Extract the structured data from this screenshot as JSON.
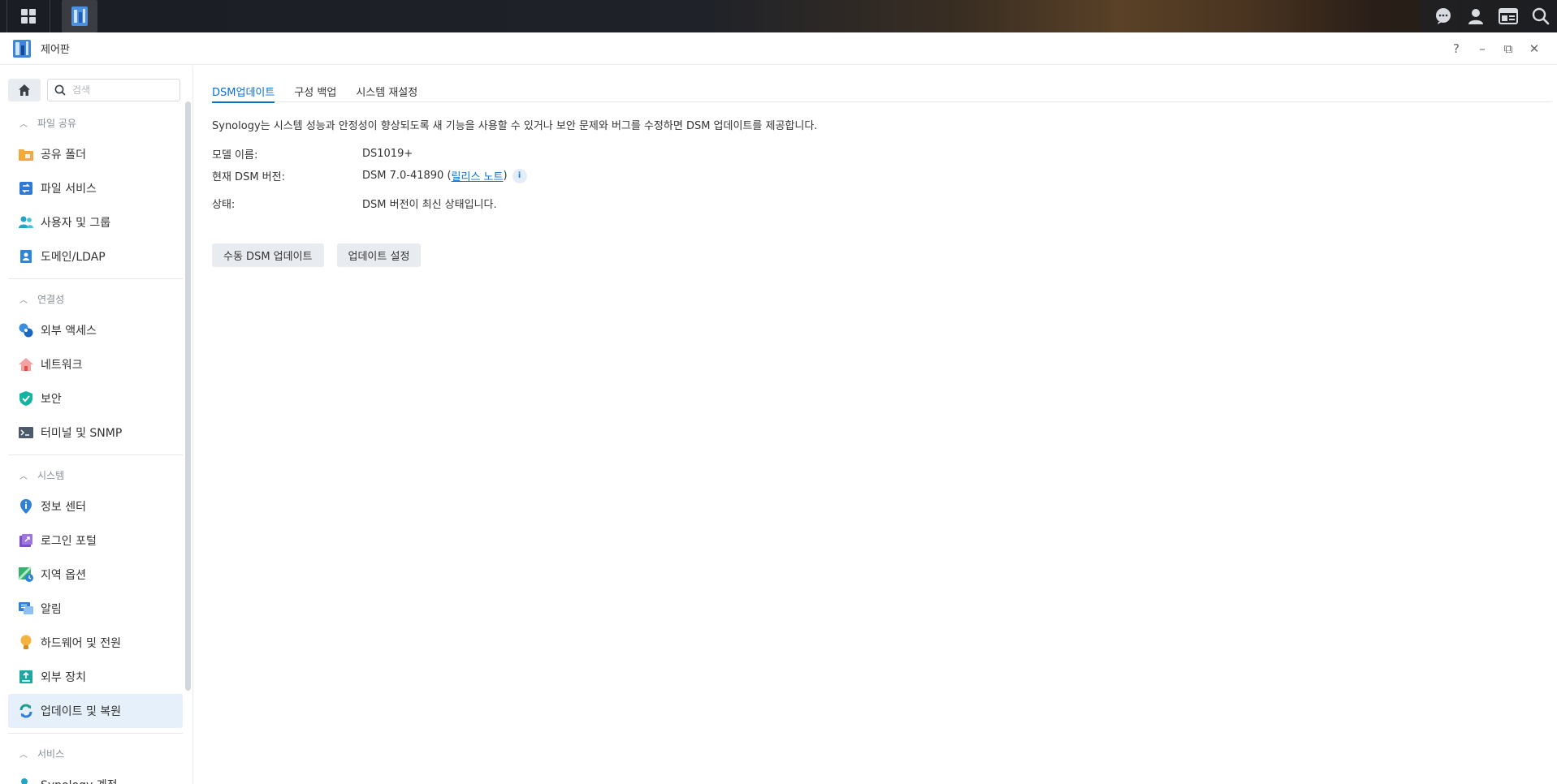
{
  "window": {
    "title": "제어판"
  },
  "window_controls": {
    "help": "?",
    "minimize": "–",
    "restore": "⧉",
    "close": "✕"
  },
  "search": {
    "placeholder": "검색"
  },
  "sidebar": {
    "sections": [
      {
        "label": "파일 공유",
        "items": [
          {
            "label": "공유 폴더",
            "icon": "shared-folder-icon"
          },
          {
            "label": "파일 서비스",
            "icon": "file-services-icon"
          },
          {
            "label": "사용자 및 그룹",
            "icon": "users-groups-icon"
          },
          {
            "label": "도메인/LDAP",
            "icon": "domain-ldap-icon"
          }
        ]
      },
      {
        "label": "연결성",
        "items": [
          {
            "label": "외부 액세스",
            "icon": "external-access-icon"
          },
          {
            "label": "네트워크",
            "icon": "network-icon"
          },
          {
            "label": "보안",
            "icon": "security-icon"
          },
          {
            "label": "터미널 및 SNMP",
            "icon": "terminal-icon"
          }
        ]
      },
      {
        "label": "시스템",
        "items": [
          {
            "label": "정보 센터",
            "icon": "info-center-icon"
          },
          {
            "label": "로그인 포털",
            "icon": "login-portal-icon"
          },
          {
            "label": "지역 옵션",
            "icon": "regional-options-icon"
          },
          {
            "label": "알림",
            "icon": "notification-icon"
          },
          {
            "label": "하드웨어 및 전원",
            "icon": "hardware-power-icon"
          },
          {
            "label": "외부 장치",
            "icon": "external-devices-icon"
          },
          {
            "label": "업데이트 및 복원",
            "icon": "update-restore-icon",
            "active": true
          }
        ]
      },
      {
        "label": "서비스",
        "items": [
          {
            "label": "Synology 계정",
            "icon": "synology-account-icon"
          }
        ]
      }
    ]
  },
  "tabs": [
    {
      "label": "DSM업데이트",
      "active": true
    },
    {
      "label": "구성 백업"
    },
    {
      "label": "시스템 재설정"
    }
  ],
  "main": {
    "intro": "Synology는 시스템 성능과 안정성이 향상되도록 새 기능을 사용할 수 있거나 보안 문제와 버그를 수정하면 DSM 업데이트를 제공합니다.",
    "model_label": "모델 이름:",
    "model_value": "DS1019+",
    "version_label": "현재 DSM 버전:",
    "version_value": "DSM 7.0-41890 (",
    "release_notes": "릴리스 노트",
    "version_close": ")",
    "info_glyph": "i",
    "status_label": "상태:",
    "status_value": "DSM 버전이 최신 상태입니다.",
    "manual_update_button": "수동 DSM 업데이트",
    "update_settings_button": "업데이트 설정"
  },
  "colors": {
    "accent": "#0b6fd0",
    "status_ok": "#0f9a14",
    "active_bg": "#e5f0fa"
  }
}
